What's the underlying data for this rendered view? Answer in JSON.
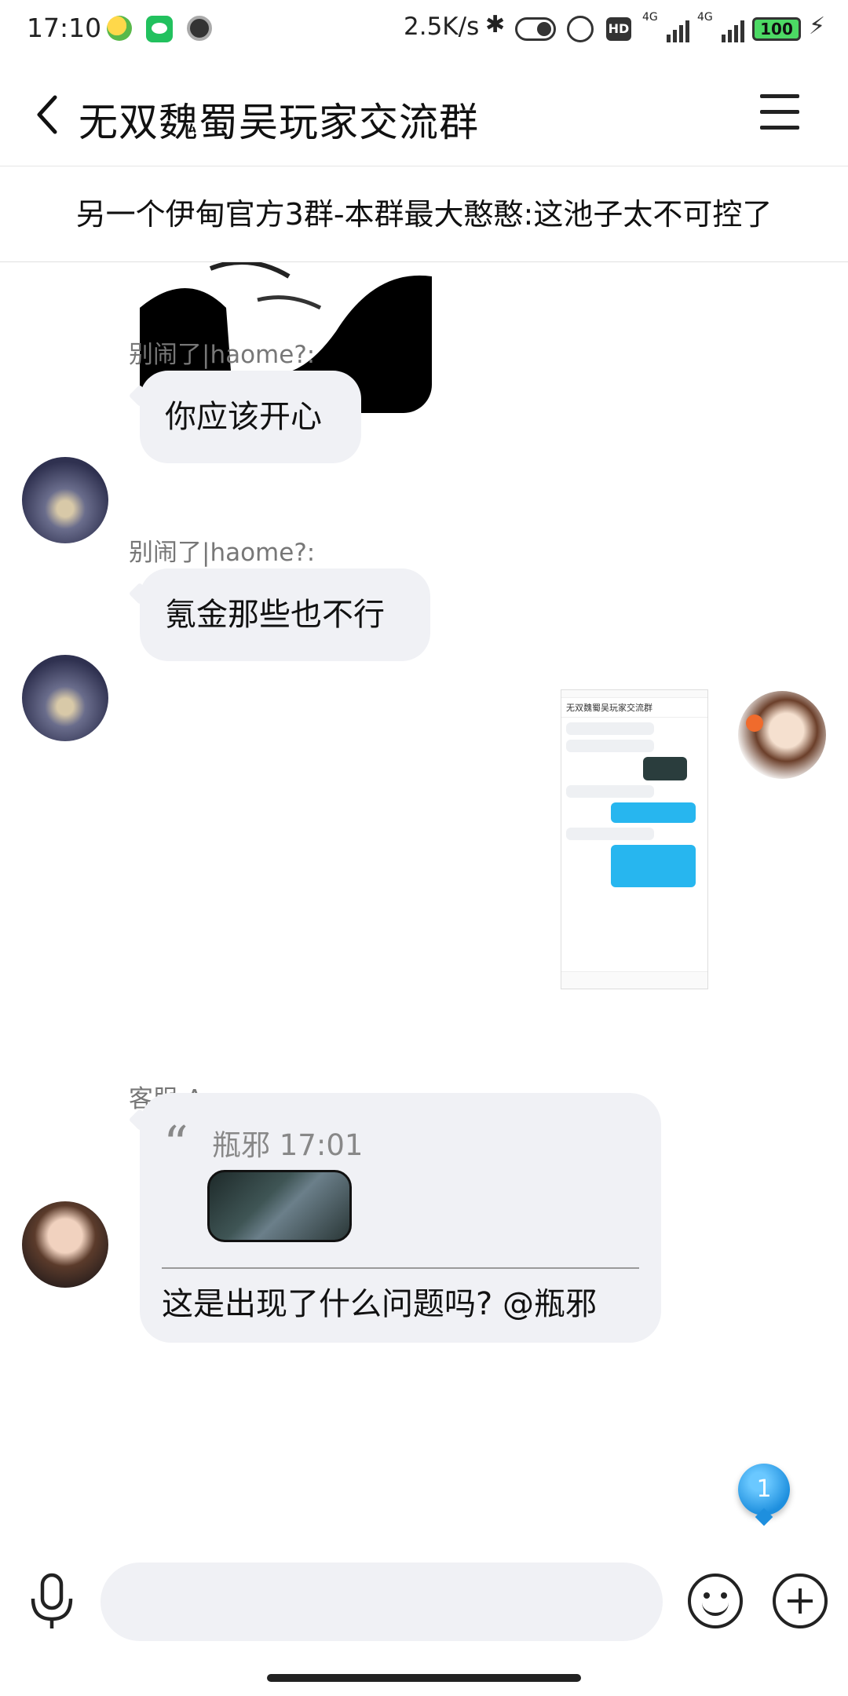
{
  "status_bar": {
    "time": "17:10",
    "net_speed": "2.5K/s",
    "network_1": "4G",
    "network_2": "4G",
    "hd_label": "HD",
    "battery": "100",
    "icons": [
      "app-icon-1",
      "wechat-icon",
      "app-icon-3",
      "bluetooth-icon",
      "toggle-icon",
      "alarm-icon",
      "hd-icon",
      "signal-icon",
      "signal-icon",
      "battery-icon",
      "charging-icon"
    ]
  },
  "header": {
    "title": "无双魏蜀吴玩家交流群",
    "back_icon": "back-chevron-icon",
    "menu_icon": "menu-icon"
  },
  "announcement": {
    "text": "另一个伊甸官方3群-本群最大憨憨:这池子太不可控了"
  },
  "messages": [
    {
      "sender": "别闹了|haome?:",
      "text": "你应该开心"
    },
    {
      "sender": "别闹了|haome?:",
      "text": "氪金那些也不行"
    },
    {
      "sender": "客服-Anna:",
      "quote_author": "瓶邪",
      "quote_time": "17:01",
      "text": "这是出现了什么问题吗? @瓶邪"
    }
  ],
  "shared_screenshot": {
    "title": "无双魏蜀吴玩家交流群"
  },
  "unread_count": "1",
  "input_bar": {
    "placeholder": "",
    "icons": [
      "microphone-icon",
      "emoji-icon",
      "plus-icon"
    ]
  }
}
